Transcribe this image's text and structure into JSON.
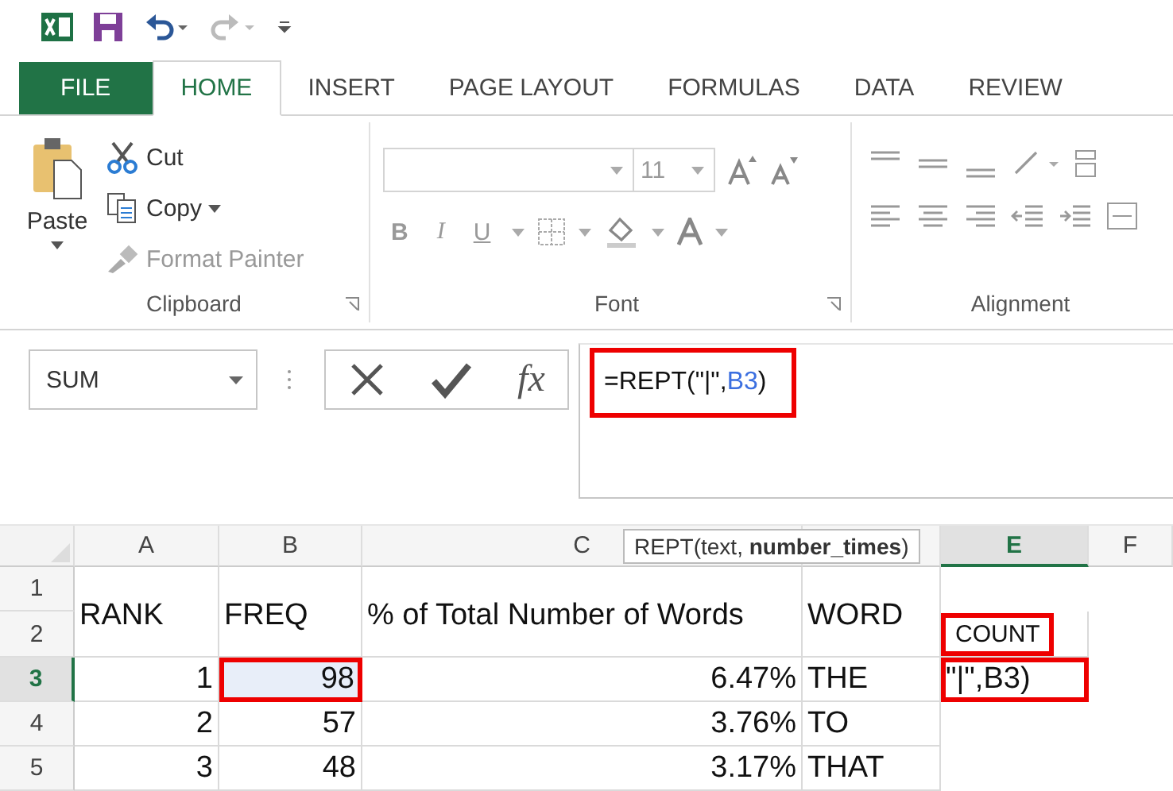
{
  "tabs": [
    {
      "label": "FILE",
      "kind": "file",
      "selected": false
    },
    {
      "label": "HOME",
      "kind": "tab",
      "selected": true
    },
    {
      "label": "INSERT",
      "kind": "tab",
      "selected": false
    },
    {
      "label": "PAGE LAYOUT",
      "kind": "tab",
      "selected": false
    },
    {
      "label": "FORMULAS",
      "kind": "tab",
      "selected": false
    },
    {
      "label": "DATA",
      "kind": "tab",
      "selected": false
    },
    {
      "label": "REVIEW",
      "kind": "tab",
      "selected": false
    }
  ],
  "clipboard": {
    "paste": "Paste",
    "label": "Clipboard",
    "items": [
      {
        "label": "Cut",
        "kind": "cut",
        "disabled": false,
        "dropdown": false
      },
      {
        "label": "Copy",
        "kind": "copy",
        "disabled": false,
        "dropdown": true
      },
      {
        "label": "Format Painter",
        "kind": "brush",
        "disabled": true,
        "dropdown": false
      }
    ]
  },
  "font": {
    "label": "Font",
    "size": "11",
    "styles": [
      "B",
      "I",
      "U"
    ]
  },
  "alignment": {
    "label": "Alignment"
  },
  "formula_bar": {
    "name_box": "SUM",
    "insert_function": "fx",
    "highlighted": true,
    "parts": [
      {
        "text": "=REPT(\"|\",",
        "kind": "plain"
      },
      {
        "text": "B3",
        "kind": "ref"
      },
      {
        "text": ")",
        "kind": "plain"
      }
    ]
  },
  "tooltip": "REPT(text, **number_times**)",
  "sheet": {
    "columns": [
      {
        "label": "A",
        "selected": false
      },
      {
        "label": "B",
        "selected": false
      },
      {
        "label": "C",
        "selected": false
      },
      {
        "selected": false
      },
      {
        "label": "E",
        "selected": true
      },
      {
        "label": "F",
        "selected": false
      }
    ],
    "row_headers": [
      {
        "label": "1",
        "selected": false
      },
      {
        "label": "2",
        "selected": false
      },
      {
        "label": "3",
        "selected": true
      },
      {
        "label": "4",
        "selected": false
      },
      {
        "label": "5",
        "selected": false
      }
    ],
    "header_cells": [
      "RANK",
      "FREQ",
      "% of Total Number of Words",
      "WORD"
    ],
    "count_cell": {
      "text": "COUNT",
      "highlighted": true
    },
    "rows": [
      {
        "cells": [
          {
            "text": "1",
            "selected": false,
            "highlighted": false
          },
          {
            "text": "98",
            "selected": true,
            "highlighted": true
          },
          {
            "text": "6.47%",
            "selected": false,
            "highlighted": false
          },
          {
            "text": "THE",
            "selected": false,
            "highlighted": false
          },
          {
            "text": "\"|\",B3)",
            "selected": false,
            "highlighted": true
          }
        ]
      },
      {
        "cells": [
          {
            "text": "2",
            "selected": false,
            "highlighted": false
          },
          {
            "text": "57",
            "selected": false,
            "highlighted": false
          },
          {
            "text": "3.76%",
            "selected": false,
            "highlighted": false
          },
          {
            "text": "TO",
            "selected": false,
            "highlighted": false
          }
        ]
      },
      {
        "cells": [
          {
            "text": "3",
            "selected": false,
            "highlighted": false
          },
          {
            "text": "48",
            "selected": false,
            "highlighted": false
          },
          {
            "text": "3.17%",
            "selected": false,
            "highlighted": false
          },
          {
            "text": "THAT",
            "selected": false,
            "highlighted": false
          }
        ]
      }
    ]
  }
}
